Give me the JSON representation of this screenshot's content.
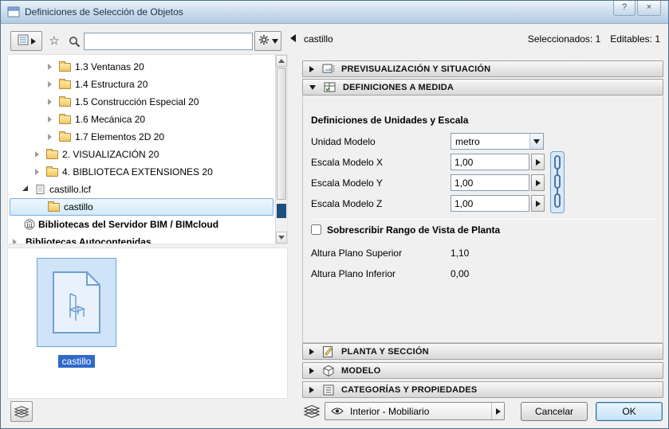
{
  "window": {
    "title": "Definiciones de Selección de Objetos",
    "help_label": "?",
    "close_label": "×"
  },
  "icons": {
    "favorites_star": "☆"
  },
  "toolbar": {
    "search_value": ""
  },
  "tree": {
    "items": [
      {
        "label": "1.3 Ventanas 20"
      },
      {
        "label": "1.4 Estructura 20"
      },
      {
        "label": "1.5 Construcción Especial 20"
      },
      {
        "label": "1.6 Mecánica 20"
      },
      {
        "label": "1.7 Elementos 2D 20"
      },
      {
        "label": "2. VISUALIZACIÓN 20"
      },
      {
        "label": "4. BIBLIOTECA EXTENSIONES 20"
      },
      {
        "label": "castillo.lcf"
      },
      {
        "label": "castillo"
      },
      {
        "label": "Bibliotecas del Servidor BIM / BIMcloud"
      },
      {
        "label": "Bibliotecas Autocontenidas"
      }
    ]
  },
  "preview": {
    "selected_item_label": "castillo"
  },
  "panel": {
    "header": {
      "name": "castillo",
      "selected": "Seleccionados: 1",
      "editable": "Editables: 1"
    },
    "sections": {
      "preview_situation": "PREVISUALIZACIÓN Y SITUACIÓN",
      "custom_settings": "DEFINICIONES A MEDIDA",
      "plan_section": "PLANTA Y SECCIÓN",
      "model": "MODELO",
      "categories_properties": "CATEGORÍAS Y PROPIEDADES"
    },
    "custom": {
      "group_title": "Definiciones de Unidades y Escala",
      "unit_label": "Unidad Modelo",
      "unit_value": "metro",
      "scale_x_label": "Escala Modelo X",
      "scale_x_value": "1,00",
      "scale_y_label": "Escala Modelo Y",
      "scale_y_value": "1,00",
      "scale_z_label": "Escala Modelo Z",
      "scale_z_value": "1,00",
      "override_checkbox_label": "Sobrescribir Rango de Vista de Planta",
      "upper_plane_label": "Altura Plano Superior",
      "upper_plane_value": "1,10",
      "lower_plane_label": "Altura Plano Inferior",
      "lower_plane_value": "0,00"
    },
    "footer": {
      "layer_value": "Interior - Mobiliario",
      "cancel_label": "Cancelar",
      "ok_label": "OK"
    }
  },
  "colors": {
    "selection_blue": "#7ab0dd",
    "preview_selected_bg": "#cfe4f8",
    "caption_highlight": "#3069c9",
    "scroll_marker": "#1d4e7e"
  }
}
